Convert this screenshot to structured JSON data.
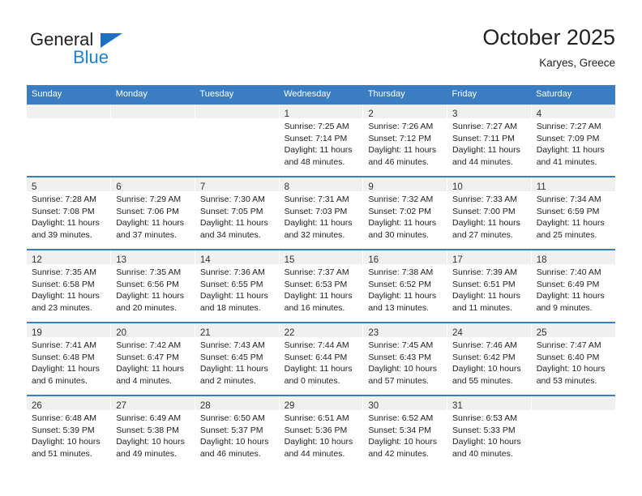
{
  "logo": {
    "word_one": "General",
    "word_two": "Blue",
    "triangle_icon": "blue-triangle-icon",
    "brand_color": "#1f7fd1"
  },
  "header": {
    "title": "October 2025",
    "subtitle": "Karyes, Greece"
  },
  "theme": {
    "header_blue": "#3a7dc0",
    "daynum_band": "#f0f0f0",
    "text": "#222222"
  },
  "calendar": {
    "weekday_headers": [
      "Sunday",
      "Monday",
      "Tuesday",
      "Wednesday",
      "Thursday",
      "Friday",
      "Saturday"
    ],
    "weeks": [
      [
        {
          "day": "",
          "empty": true,
          "lines": []
        },
        {
          "day": "",
          "empty": true,
          "lines": []
        },
        {
          "day": "",
          "empty": true,
          "lines": []
        },
        {
          "day": "1",
          "empty": false,
          "lines": [
            "Sunrise: 7:25 AM",
            "Sunset: 7:14 PM",
            "Daylight: 11 hours",
            "and 48 minutes."
          ]
        },
        {
          "day": "2",
          "empty": false,
          "lines": [
            "Sunrise: 7:26 AM",
            "Sunset: 7:12 PM",
            "Daylight: 11 hours",
            "and 46 minutes."
          ]
        },
        {
          "day": "3",
          "empty": false,
          "lines": [
            "Sunrise: 7:27 AM",
            "Sunset: 7:11 PM",
            "Daylight: 11 hours",
            "and 44 minutes."
          ]
        },
        {
          "day": "4",
          "empty": false,
          "lines": [
            "Sunrise: 7:27 AM",
            "Sunset: 7:09 PM",
            "Daylight: 11 hours",
            "and 41 minutes."
          ]
        }
      ],
      [
        {
          "day": "5",
          "empty": false,
          "lines": [
            "Sunrise: 7:28 AM",
            "Sunset: 7:08 PM",
            "Daylight: 11 hours",
            "and 39 minutes."
          ]
        },
        {
          "day": "6",
          "empty": false,
          "lines": [
            "Sunrise: 7:29 AM",
            "Sunset: 7:06 PM",
            "Daylight: 11 hours",
            "and 37 minutes."
          ]
        },
        {
          "day": "7",
          "empty": false,
          "lines": [
            "Sunrise: 7:30 AM",
            "Sunset: 7:05 PM",
            "Daylight: 11 hours",
            "and 34 minutes."
          ]
        },
        {
          "day": "8",
          "empty": false,
          "lines": [
            "Sunrise: 7:31 AM",
            "Sunset: 7:03 PM",
            "Daylight: 11 hours",
            "and 32 minutes."
          ]
        },
        {
          "day": "9",
          "empty": false,
          "lines": [
            "Sunrise: 7:32 AM",
            "Sunset: 7:02 PM",
            "Daylight: 11 hours",
            "and 30 minutes."
          ]
        },
        {
          "day": "10",
          "empty": false,
          "lines": [
            "Sunrise: 7:33 AM",
            "Sunset: 7:00 PM",
            "Daylight: 11 hours",
            "and 27 minutes."
          ]
        },
        {
          "day": "11",
          "empty": false,
          "lines": [
            "Sunrise: 7:34 AM",
            "Sunset: 6:59 PM",
            "Daylight: 11 hours",
            "and 25 minutes."
          ]
        }
      ],
      [
        {
          "day": "12",
          "empty": false,
          "lines": [
            "Sunrise: 7:35 AM",
            "Sunset: 6:58 PM",
            "Daylight: 11 hours",
            "and 23 minutes."
          ]
        },
        {
          "day": "13",
          "empty": false,
          "lines": [
            "Sunrise: 7:35 AM",
            "Sunset: 6:56 PM",
            "Daylight: 11 hours",
            "and 20 minutes."
          ]
        },
        {
          "day": "14",
          "empty": false,
          "lines": [
            "Sunrise: 7:36 AM",
            "Sunset: 6:55 PM",
            "Daylight: 11 hours",
            "and 18 minutes."
          ]
        },
        {
          "day": "15",
          "empty": false,
          "lines": [
            "Sunrise: 7:37 AM",
            "Sunset: 6:53 PM",
            "Daylight: 11 hours",
            "and 16 minutes."
          ]
        },
        {
          "day": "16",
          "empty": false,
          "lines": [
            "Sunrise: 7:38 AM",
            "Sunset: 6:52 PM",
            "Daylight: 11 hours",
            "and 13 minutes."
          ]
        },
        {
          "day": "17",
          "empty": false,
          "lines": [
            "Sunrise: 7:39 AM",
            "Sunset: 6:51 PM",
            "Daylight: 11 hours",
            "and 11 minutes."
          ]
        },
        {
          "day": "18",
          "empty": false,
          "lines": [
            "Sunrise: 7:40 AM",
            "Sunset: 6:49 PM",
            "Daylight: 11 hours",
            "and 9 minutes."
          ]
        }
      ],
      [
        {
          "day": "19",
          "empty": false,
          "lines": [
            "Sunrise: 7:41 AM",
            "Sunset: 6:48 PM",
            "Daylight: 11 hours",
            "and 6 minutes."
          ]
        },
        {
          "day": "20",
          "empty": false,
          "lines": [
            "Sunrise: 7:42 AM",
            "Sunset: 6:47 PM",
            "Daylight: 11 hours",
            "and 4 minutes."
          ]
        },
        {
          "day": "21",
          "empty": false,
          "lines": [
            "Sunrise: 7:43 AM",
            "Sunset: 6:45 PM",
            "Daylight: 11 hours",
            "and 2 minutes."
          ]
        },
        {
          "day": "22",
          "empty": false,
          "lines": [
            "Sunrise: 7:44 AM",
            "Sunset: 6:44 PM",
            "Daylight: 11 hours",
            "and 0 minutes."
          ]
        },
        {
          "day": "23",
          "empty": false,
          "lines": [
            "Sunrise: 7:45 AM",
            "Sunset: 6:43 PM",
            "Daylight: 10 hours",
            "and 57 minutes."
          ]
        },
        {
          "day": "24",
          "empty": false,
          "lines": [
            "Sunrise: 7:46 AM",
            "Sunset: 6:42 PM",
            "Daylight: 10 hours",
            "and 55 minutes."
          ]
        },
        {
          "day": "25",
          "empty": false,
          "lines": [
            "Sunrise: 7:47 AM",
            "Sunset: 6:40 PM",
            "Daylight: 10 hours",
            "and 53 minutes."
          ]
        }
      ],
      [
        {
          "day": "26",
          "empty": false,
          "lines": [
            "Sunrise: 6:48 AM",
            "Sunset: 5:39 PM",
            "Daylight: 10 hours",
            "and 51 minutes."
          ]
        },
        {
          "day": "27",
          "empty": false,
          "lines": [
            "Sunrise: 6:49 AM",
            "Sunset: 5:38 PM",
            "Daylight: 10 hours",
            "and 49 minutes."
          ]
        },
        {
          "day": "28",
          "empty": false,
          "lines": [
            "Sunrise: 6:50 AM",
            "Sunset: 5:37 PM",
            "Daylight: 10 hours",
            "and 46 minutes."
          ]
        },
        {
          "day": "29",
          "empty": false,
          "lines": [
            "Sunrise: 6:51 AM",
            "Sunset: 5:36 PM",
            "Daylight: 10 hours",
            "and 44 minutes."
          ]
        },
        {
          "day": "30",
          "empty": false,
          "lines": [
            "Sunrise: 6:52 AM",
            "Sunset: 5:34 PM",
            "Daylight: 10 hours",
            "and 42 minutes."
          ]
        },
        {
          "day": "31",
          "empty": false,
          "lines": [
            "Sunrise: 6:53 AM",
            "Sunset: 5:33 PM",
            "Daylight: 10 hours",
            "and 40 minutes."
          ]
        },
        {
          "day": "",
          "empty": true,
          "lines": []
        }
      ]
    ]
  }
}
